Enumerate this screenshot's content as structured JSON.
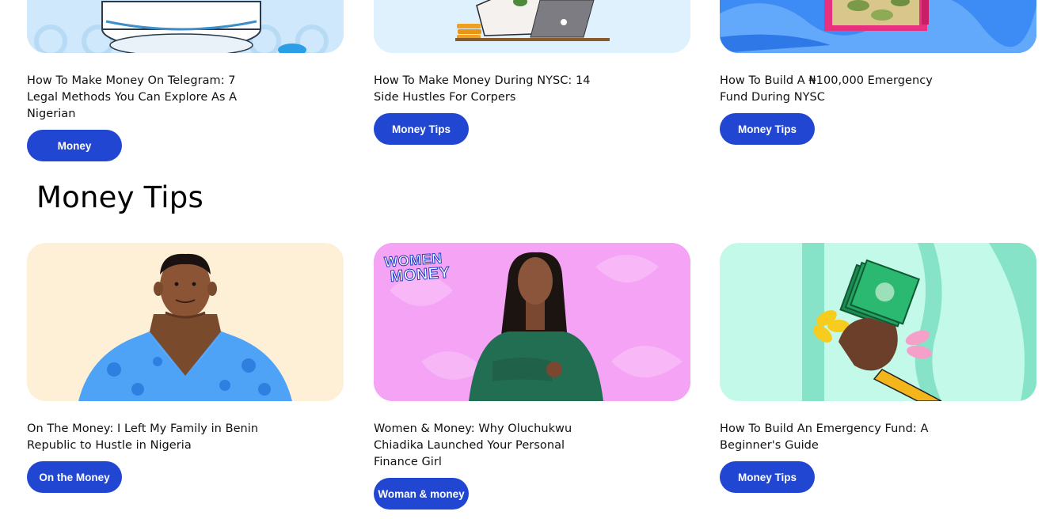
{
  "top_row": [
    {
      "title": "How To Make Money On Telegram: 7 Legal Methods You Can Explore As A Nigerian",
      "tag": "Money"
    },
    {
      "title": "How To Make Money During NYSC: 14 Side Hustles For Corpers",
      "tag": "Money Tips"
    },
    {
      "title": "How To Build A ₦100,000 Emergency Fund During NYSC",
      "tag": "Money Tips"
    }
  ],
  "section": {
    "heading": "Money Tips"
  },
  "bottom_row": [
    {
      "title": "On The Money: I Left My Family in Benin Republic to Hustle in Nigeria",
      "tag": "On the Money"
    },
    {
      "title": "Women & Money: Why Oluchukwu Chiadika Launched Your Personal Finance Girl",
      "tag": "Woman & money",
      "logo_line1": "WOMEN",
      "logo_line2": "MONEY"
    },
    {
      "title": "How To Build An Emergency Fund: A Beginner's Guide",
      "tag": "Money Tips"
    }
  ],
  "colors": {
    "tag_bg": "#2146d2",
    "thumb_telegram": "#cfe8fb",
    "thumb_nysc": "#dff1fd",
    "thumb_fund_nysc": "#3d8cf5",
    "thumb_onthemoney": "#fef0d6",
    "thumb_women": "#f5a3f5",
    "thumb_guide": "#c2f9e8"
  }
}
